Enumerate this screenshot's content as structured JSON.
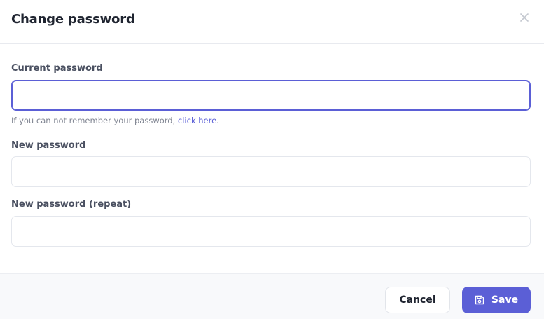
{
  "dialog": {
    "title": "Change password",
    "close_icon": "close-icon"
  },
  "form": {
    "current_password": {
      "label": "Current password",
      "value": "",
      "placeholder": ""
    },
    "hint": {
      "text": "If you can not remember your password, ",
      "link": "click here",
      "suffix": "."
    },
    "new_password": {
      "label": "New password",
      "value": "",
      "placeholder": ""
    },
    "new_password_repeat": {
      "label": "New password (repeat)",
      "value": "",
      "placeholder": ""
    }
  },
  "footer": {
    "cancel_label": "Cancel",
    "save_label": "Save",
    "save_icon": "floppy-disk-icon"
  },
  "colors": {
    "accent": "#5b5fd6",
    "title_text": "#1f2430",
    "label_text": "#4a5061",
    "hint_text": "#808592",
    "footer_bg": "#f8f9fb"
  }
}
